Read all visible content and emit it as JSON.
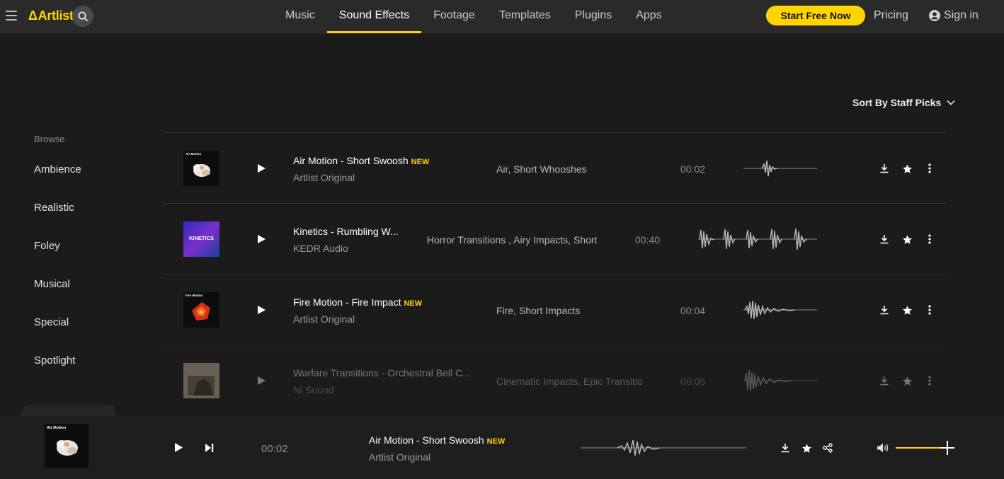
{
  "header": {
    "logo": "Artlist",
    "nav": [
      "Music",
      "Sound Effects",
      "Footage",
      "Templates",
      "Plugins",
      "Apps"
    ],
    "active_nav": "Sound Effects",
    "start_label": "Start Free Now",
    "pricing_label": "Pricing",
    "signin_label": "Sign in"
  },
  "sort": {
    "label": "Sort By Staff Picks"
  },
  "sidebar": {
    "browse_label": "Browse",
    "items": [
      "Ambience",
      "Realistic",
      "Foley",
      "Musical",
      "Special",
      "Spotlight"
    ]
  },
  "tracks": [
    {
      "title": "Air Motion - Short Swoosh",
      "is_new": true,
      "new_label": "NEW",
      "artist": "Artlist Original",
      "tags": "Air, Short Whooshes",
      "duration": "00:02",
      "art_caption": "Air Motion"
    },
    {
      "title": "Kinetics - Rumbling W...",
      "is_new": false,
      "new_label": "",
      "artist": "KEDR Audio",
      "tags": "Horror Transitions , Airy Impacts, Short \\",
      "duration": "00:40",
      "art_caption": "KINETICS"
    },
    {
      "title": "Fire Motion - Fire Impact",
      "is_new": true,
      "new_label": "NEW",
      "artist": "Artlist Original",
      "tags": "Fire, Short Impacts",
      "duration": "00:04",
      "art_caption": "Fire Motion"
    },
    {
      "title": "Warfare Transitions - Orchestral Bell C...",
      "is_new": false,
      "new_label": "",
      "artist": "Ni Sound",
      "tags": "Cinematic Impacts, Epic Transition",
      "duration": "00:05",
      "art_caption": ""
    }
  ],
  "player": {
    "title": "Air Motion - Short Swoosh",
    "new_label": "NEW",
    "artist": "Artlist Original",
    "time": "00:02",
    "art_caption": "Air Motion"
  },
  "colors": {
    "accent": "#ffd400",
    "background": "#1b1b1b",
    "nav_bg": "#2a2a2a"
  },
  "icons": {
    "menu": "hamburger-icon",
    "search": "search-icon",
    "user": "user-icon",
    "sort": "chevron-down-icon",
    "play": "play-icon",
    "next": "skip-next-icon",
    "download": "download-icon",
    "favorite": "star-icon",
    "more": "more-vertical-icon",
    "share": "share-icon",
    "volume": "volume-icon"
  }
}
